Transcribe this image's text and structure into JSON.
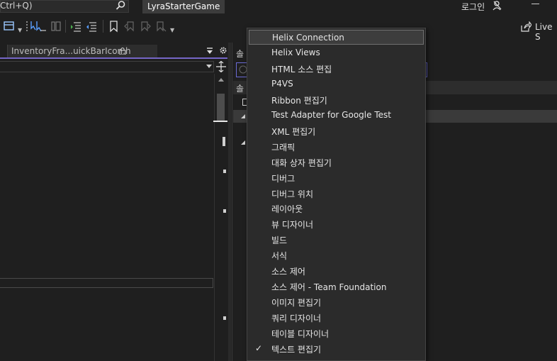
{
  "titlebar": {
    "search_text": "Ctrl+Q)",
    "solution_name": "LyraStarterGame",
    "login_label": "로그인"
  },
  "toolbar": {
    "live_share_label": "Live S"
  },
  "editor": {
    "tab_label": "InventoryFra...uickBarIcon.h"
  },
  "panel": {
    "title": "솔",
    "header": "솔"
  },
  "context_menu": {
    "items": [
      {
        "label": "Helix Connection",
        "checked": false,
        "highlighted": true
      },
      {
        "label": "Helix Views",
        "checked": false
      },
      {
        "label": "HTML 소스 편집",
        "checked": false
      },
      {
        "label": "P4VS",
        "checked": false
      },
      {
        "label": "Ribbon 편집기",
        "checked": false
      },
      {
        "label": "Test Adapter for Google Test",
        "checked": false
      },
      {
        "label": "XML 편집기",
        "checked": false
      },
      {
        "label": "그래픽",
        "checked": false
      },
      {
        "label": "대화 상자 편집기",
        "checked": false
      },
      {
        "label": "디버그",
        "checked": false
      },
      {
        "label": "디버그 위치",
        "checked": false
      },
      {
        "label": "레이아웃",
        "checked": false
      },
      {
        "label": "뷰 디자이너",
        "checked": false
      },
      {
        "label": "빌드",
        "checked": false
      },
      {
        "label": "서식",
        "checked": false
      },
      {
        "label": "소스 제어",
        "checked": false
      },
      {
        "label": "소스 제어 - Team Foundation",
        "checked": false
      },
      {
        "label": "이미지 편집기",
        "checked": false
      },
      {
        "label": "쿼리 디자이너",
        "checked": false
      },
      {
        "label": "테이블 디자이너",
        "checked": false
      },
      {
        "label": "텍스트 편집기",
        "checked": true
      }
    ],
    "check_glyph": "✓"
  },
  "colors": {
    "accent": "#7566c6",
    "menu_bg": "#2b2b2b",
    "menu_highlight": "#3d3d3d"
  }
}
